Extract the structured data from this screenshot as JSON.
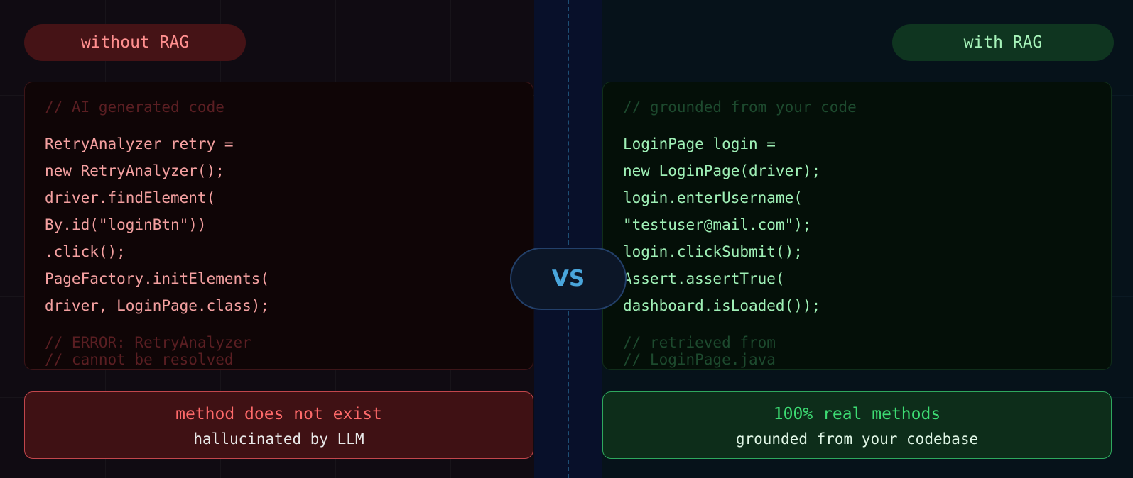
{
  "left": {
    "label": "without RAG",
    "comment_top": "// AI generated code",
    "code": [
      "RetryAnalyzer retry =",
      "new RetryAnalyzer();",
      "driver.findElement(",
      "By.id(\"loginBtn\"))",
      ".click();",
      "PageFactory.initElements(",
      "driver, LoginPage.class);"
    ],
    "comment_bottom": [
      "// ERROR: RetryAnalyzer",
      "// cannot be resolved"
    ],
    "verdict_title": "method does not exist",
    "verdict_sub": "hallucinated by LLM"
  },
  "divider_label": "VS",
  "right": {
    "label": "with RAG",
    "comment_top": "// grounded from your code",
    "code": [
      "LoginPage login =",
      "new LoginPage(driver);",
      "login.enterUsername(",
      "\"testuser@mail.com\");",
      "login.clickSubmit();",
      "Assert.assertTrue(",
      "dashboard.isLoaded());"
    ],
    "comment_bottom": [
      "// retrieved from",
      "// LoginPage.java"
    ],
    "verdict_title": "100% real methods",
    "verdict_sub": "grounded from your codebase"
  },
  "colors": {
    "bad_accent": "#ff6a6a",
    "good_accent": "#3ddc73",
    "vs_accent": "#4aa6dc"
  }
}
